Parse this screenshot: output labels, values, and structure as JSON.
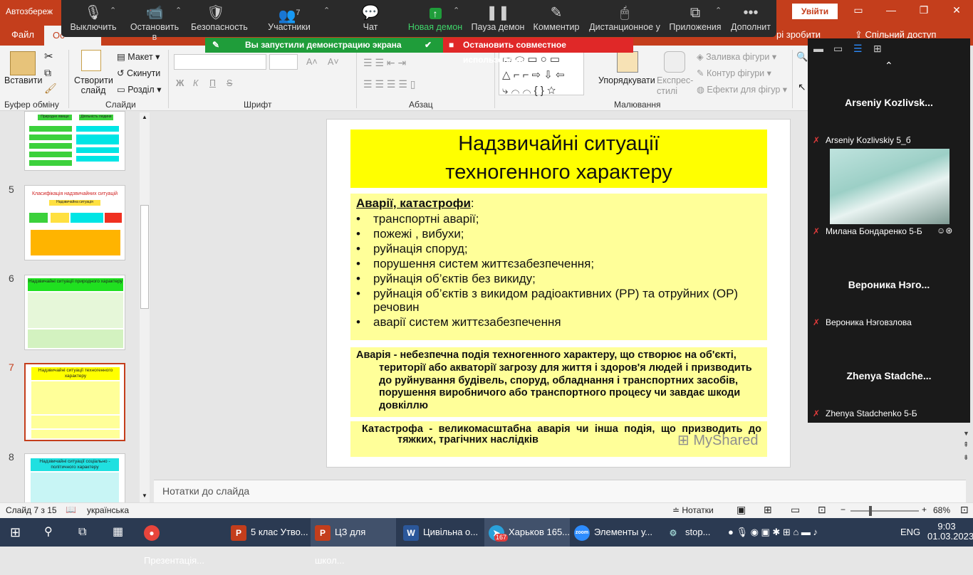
{
  "titlebar": {
    "app_title": "Автозбереж",
    "signin": "Увійти"
  },
  "menu": {
    "file": "Файл",
    "home": "Ос",
    "help_text": "рі зробити",
    "share": "Спільний доступ"
  },
  "zoom": {
    "mute": "Выключить",
    "video": "Остановить в",
    "security": "Безопасность",
    "participants": "Участники",
    "participants_count": "7",
    "chat": "Чат",
    "new_share": "Новая демон",
    "pause": "Пауза демон",
    "annotate": "Комментир",
    "remote": "Дистанционное у",
    "apps": "Приложения",
    "more": "Дополнит",
    "sharing_notice": "Вы запустили демонстрацию экрана",
    "stop_share": "Остановить совместное использование"
  },
  "ribbon": {
    "paste": "Вставити",
    "clipboard_group": "Буфер обміну",
    "new_slide": "Створити слайд",
    "layout": "Макет",
    "reset": "Скинути",
    "section": "Розділ",
    "slides_group": "Слайди",
    "font_group": "Шрифт",
    "paragraph_group": "Абзац",
    "drawing_group": "Малювання",
    "arrange": "Упорядкувати",
    "quick_styles": "Експрес-стилі",
    "shape_fill": "Заливка фігури",
    "shape_outline": "Контур фігури",
    "shape_effects": "Ефекти для фігур",
    "bold": "Ж",
    "italic": "К",
    "underline": "П",
    "strike": "S"
  },
  "thumbnails": {
    "n5": "5",
    "n6": "6",
    "n7": "7",
    "n8": "8",
    "t5_title": "Класифікація надзвичайних ситуацій",
    "t5_sub": "Надзвичайна ситуація",
    "t6_title": "Надзвичайні ситуації природного характеру",
    "t7_title": "Надзвичайні ситуації техногенного характеру",
    "t8_title": "Надзвичайні ситуації соціально - політичного характеру",
    "t4_a": "Природне явище",
    "t4_b": "Діяльність людини"
  },
  "slide": {
    "title_line1": "Надзвичайні ситуації",
    "title_line2": "техногенного характеру",
    "list_heading": "Аварії, катастрофи",
    "items": [
      "транспортні аварії;",
      "пожежі , вибухи;",
      "руйнація споруд;",
      "порушення систем життєзабезпечення;",
      "руйнація об’єктів без викиду;",
      "руйнація об’єктів з викидом радіоактивних (РР) та отруйних (ОР) речовин",
      "аварії систем життєзабезпечення"
    ],
    "def_accident": "Аварія - небезпечна подія техногенного характеру,  що створює на об'єкті,  території або акваторії загрозу для життя і здоров'я людей і призводить до руйнування будівель,  споруд,  обладнання  і  транспортних  засобів,  порушення  виробничого  або  транспортного процесу чи завдає шкоди довкіллю",
    "def_catastrophe": "Катастрофа  -   великомасштабна   аварія   чи   інша   подія,   що призводить до тяжких, трагічних наслідків",
    "watermark": "MyShared"
  },
  "notes_placeholder": "Нотатки до слайда",
  "status": {
    "slide_info": "Слайд 7 з 15",
    "language": "українська",
    "notes": "Нотатки",
    "zoom_level": "68%"
  },
  "gallery": {
    "p1_name": "Arseniy  Kozlivsk...",
    "p1_caption": "Arseniy Kozlivskiy 5_б",
    "p2_caption": "Милана Бондаренко 5-Б",
    "p3_name": "Вероника  Нэго...",
    "p3_caption": "Вероника Нэговзлова",
    "p4_name": "Zhenya  Stadche...",
    "p4_caption": "Zhenya Stadchenko 5-Б"
  },
  "taskbar": {
    "item1": "Презентація...",
    "item2": "5 клас Утво...",
    "item3": "ЦЗ для школ...",
    "item4": "Цивільна о...",
    "item5": "Харьков 165...",
    "item5_badge": "167",
    "item6": "Элементы у...",
    "item7": "stop...",
    "lang": "ENG",
    "time": "9:03",
    "date": "01.03.2023"
  },
  "colors": {
    "accent": "#c43e1c",
    "slide_yellow": "#ffff00",
    "slide_box": "#ffff99",
    "zoom_green": "#1f9d3a",
    "zoom_red": "#e02828"
  }
}
